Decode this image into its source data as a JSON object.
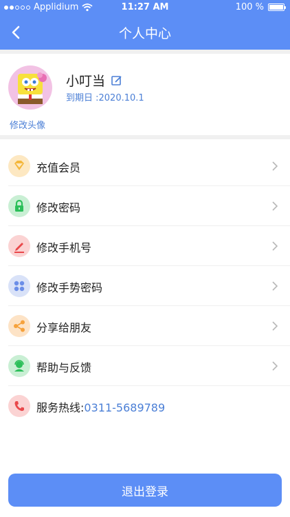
{
  "status_bar": {
    "carrier": "Applidium",
    "time": "11:27 AM",
    "battery": "100 %"
  },
  "nav": {
    "title": "个人中心"
  },
  "profile": {
    "username": "小叮当",
    "expire": "到期日 :2020.10.1",
    "avatar_label": "修改头像"
  },
  "menu": {
    "items": [
      {
        "label": "充值会员",
        "icon": "diamond-icon",
        "color": "#f4b73c"
      },
      {
        "label": "修改密码",
        "icon": "lock-icon",
        "color": "#2cbf5a"
      },
      {
        "label": "修改手机号",
        "icon": "pen-icon",
        "color": "#e9484b"
      },
      {
        "label": "修改手势密码",
        "icon": "grid-dots-icon",
        "color": "#6b8ee8"
      },
      {
        "label": "分享给朋友",
        "icon": "share-icon",
        "color": "#f6a23c"
      },
      {
        "label": "帮助与反馈",
        "icon": "support-icon",
        "color": "#2cbf5a"
      }
    ],
    "hotline_label": "服务热线:",
    "hotline_number": "0311-5689789"
  },
  "logout_label": "退出登录",
  "colors": {
    "accent": "#5c8ef6",
    "link": "#4b7fd6"
  }
}
